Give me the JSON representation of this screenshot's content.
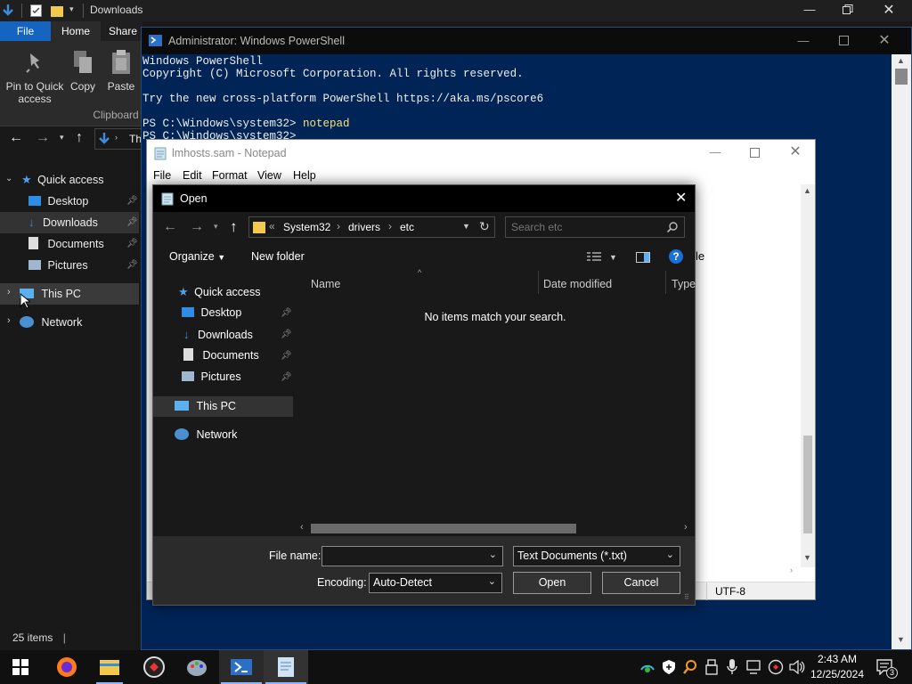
{
  "explorer": {
    "title": "Downloads",
    "tabs": {
      "file": "File",
      "home": "Home",
      "share": "Share"
    },
    "ribbon": {
      "pin": "Pin to Quick access",
      "copy": "Copy",
      "paste": "Paste",
      "group_clipboard": "Clipboard"
    },
    "address_fragment": "Th",
    "nav": {
      "quick_access": "Quick access",
      "desktop": "Desktop",
      "downloads": "Downloads",
      "documents": "Documents",
      "pictures": "Pictures",
      "this_pc": "This PC",
      "network": "Network"
    },
    "status": "25 items"
  },
  "powershell": {
    "title": "Administrator: Windows PowerShell",
    "lines": [
      "Windows PowerShell",
      "Copyright (C) Microsoft Corporation. All rights reserved.",
      "",
      "Try the new cross-platform PowerShell https://aka.ms/pscore6",
      "",
      "PS C:\\Windows\\system32> notepad",
      "PS C:\\Windows\\system32>"
    ],
    "colors": {
      "background": "#012456",
      "text": "#eeeeee",
      "command": "#f7e07a"
    }
  },
  "notepad": {
    "title": "lmhosts.sam - Notepad",
    "menu": [
      "File",
      "Edit",
      "Format",
      "View",
      "Help"
    ],
    "status_encoding": "UTF-8",
    "hidden_text_fragment": "le"
  },
  "open_dialog": {
    "title": "Open",
    "breadcrumb": [
      "System32",
      "drivers",
      "etc"
    ],
    "search_placeholder": "Search etc",
    "toolbar": {
      "organize": "Organize",
      "new_folder": "New folder"
    },
    "nav": {
      "quick_access": "Quick access",
      "desktop": "Desktop",
      "downloads": "Downloads",
      "documents": "Documents",
      "pictures": "Pictures",
      "this_pc": "This PC",
      "network": "Network"
    },
    "columns": {
      "name": "Name",
      "date_modified": "Date modified",
      "type": "Type"
    },
    "empty_message": "No items match your search.",
    "file_name_label": "File name:",
    "file_name_value": "",
    "file_type": "Text Documents (*.txt)",
    "encoding_label": "Encoding:",
    "encoding_value": "Auto-Detect",
    "open_button": "Open",
    "cancel_button": "Cancel"
  },
  "taskbar": {
    "time": "2:43 AM",
    "date": "12/25/2024",
    "notification_count": "3",
    "apps": [
      "windows-start-icon",
      "firefox-icon",
      "file-explorer-icon",
      "app-icon",
      "paint-icon",
      "powershell-icon",
      "notepad-icon"
    ]
  }
}
